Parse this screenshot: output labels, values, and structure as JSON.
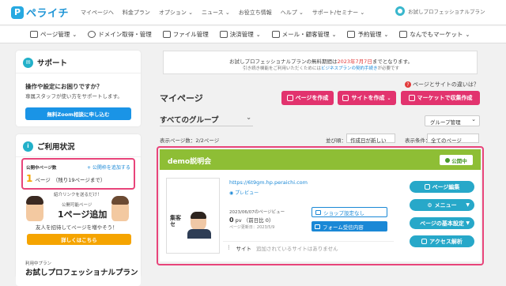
{
  "brand": {
    "name": "ペライチ",
    "mark": "P"
  },
  "topnav": [
    "マイページへ",
    "料金プラン",
    "オプション",
    "ニュース",
    "お役立ち情報",
    "ヘルプ",
    "サポート/セミナー"
  ],
  "user": {
    "name": "お試しプロフェッショナルプラン"
  },
  "menubar": [
    "ページ管理",
    "ドメイン取得・管理",
    "ファイル管理",
    "決済管理",
    "メール・顧客管理",
    "予約管理",
    "なんでもマーケット"
  ],
  "support": {
    "title": "サポート",
    "question": "操作や設定にお困りですか？",
    "desc": "専属スタッフが使い方をサポートします。",
    "button": "無料Zoom相談に申し込む"
  },
  "usage": {
    "title": "ご利用状況",
    "published_label": "公開中ページ数",
    "add_link": "+ 公開枠を追加する",
    "count": "1",
    "unit": "ページ",
    "remaining": "（残り19ページまで）",
    "invite_tag": "紹介リンクを送るだけ！",
    "invite_line1": "公開可能ページ",
    "invite_line2": "1ページ追加",
    "invite_desc": "友人を招待してページを増やそう！",
    "detail_button": "詳しくはこちら",
    "plan_label": "利用中プラン",
    "plan_name": "お試しプロフェッショナルプラン"
  },
  "notice": {
    "line1_pre": "お試しプロフェッショナルプランの無料期間は",
    "line1_date": "2023年7月7日",
    "line1_post": "までとなります。",
    "line2_pre": "引き続き機能をご利用いただくためには",
    "line2_link": "ビジネスプランの契約手続き",
    "line2_post": "が必要です"
  },
  "help": {
    "label": "ページとサイトの違いは？"
  },
  "main": {
    "title": "マイページ",
    "create_page": "ページを作成",
    "create_site": "サイトを作成",
    "market": "マーケットで収集作成",
    "group": "すべてのグループ",
    "group_manage": "グループ管理",
    "count_text": "表示ページ数：2/2ページ",
    "sort_label": "並び順：",
    "sort_value": "作成日が新しい",
    "filter_label": "表示条件：",
    "filter_value": "全てのページ"
  },
  "site_card": {
    "name": "demo説明会",
    "status": "公開中",
    "url": "https://6t9gm.hp.peraichi.com",
    "preview": "プレビュー",
    "stats_date": "2023/06/07のページビュー",
    "pv_num": "0",
    "pv_unit": "pv",
    "pv_prev": "（前日比 0）",
    "updated": "ページ更新日：2023/5/9",
    "shop_button": "ショップ設定なし",
    "form_button": "フォーム受信内容",
    "site_label": "サイト",
    "site_value": "追加されているサイトはありません",
    "thumb_text": "集客セ",
    "buttons": [
      "ページ編集",
      "メニュー",
      "ページの基本設定",
      "アクセス解析"
    ]
  }
}
